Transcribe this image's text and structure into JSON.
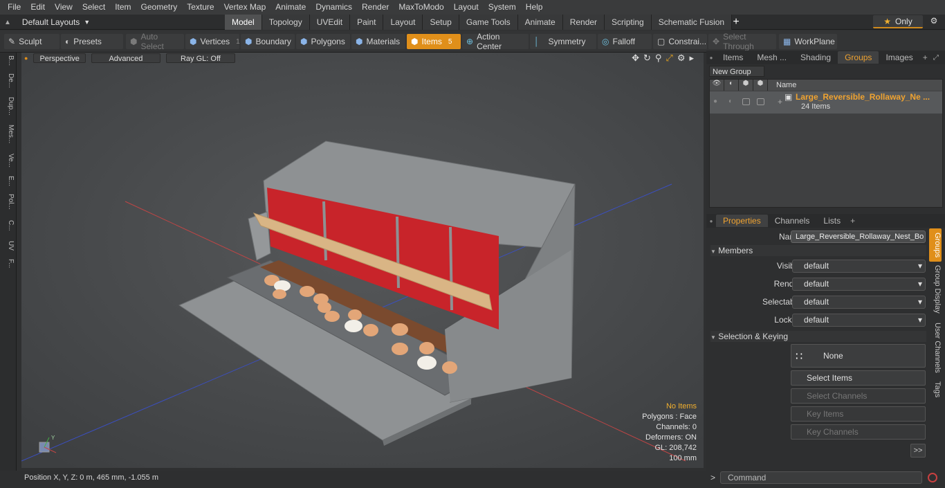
{
  "menu": [
    "File",
    "Edit",
    "View",
    "Select",
    "Item",
    "Geometry",
    "Texture",
    "Vertex Map",
    "Animate",
    "Dynamics",
    "Render",
    "MaxToModo",
    "Layout",
    "System",
    "Help"
  ],
  "layout_selector": "Default Layouts",
  "mode_tabs": [
    "Model",
    "Topology",
    "UVEdit",
    "Paint",
    "Layout",
    "Setup",
    "Game Tools",
    "Animate",
    "Render",
    "Scripting",
    "Schematic Fusion"
  ],
  "active_mode_tab": "Model",
  "only_label": "Only",
  "toolbar": {
    "sculpt": "Sculpt",
    "presets": "Presets",
    "auto_select": "Auto Select",
    "vertices": "Vertices",
    "vertices_count": "1",
    "boundary": "Boundary",
    "polygons": "Polygons",
    "materials": "Materials",
    "items": "Items",
    "items_count": "5",
    "action_center": "Action Center",
    "symmetry": "Symmetry",
    "falloff": "Falloff",
    "constraints": "Constrai...",
    "select_through": "Select Through",
    "workplane": "WorkPlane"
  },
  "left_tabs": [
    "B...",
    "De...",
    "Dup...",
    "Mes...",
    "Ve...",
    "E...",
    "Pol...",
    "C...",
    "UV",
    "F..."
  ],
  "viewport": {
    "view_mode": "Perspective",
    "shading": "Advanced",
    "raygl": "Ray GL: Off",
    "hud": {
      "items": "No Items",
      "polygons": "Polygons : Face",
      "channels": "Channels: 0",
      "deformers": "Deformers: ON",
      "gl": "GL: 208,742",
      "scale": "100 mm"
    }
  },
  "status": {
    "position": "Position X, Y, Z:   0 m, 465 mm, -1.055 m"
  },
  "right_panel": {
    "tabs": [
      "Items",
      "Mesh ...",
      "Shading",
      "Groups",
      "Images"
    ],
    "active_tab": "Groups",
    "new_group": "New Group",
    "col_name": "Name",
    "group_name": "Large_Reversible_Rollaway_Ne ...",
    "group_count": "24 Items",
    "prop_tabs": [
      "Properties",
      "Channels",
      "Lists"
    ],
    "active_prop_tab": "Properties",
    "name_label": "Name",
    "name_value": "Large_Reversible_Rollaway_Nest_Bo",
    "members_header": "Members",
    "visible_label": "Visible",
    "visible_value": "default",
    "render_label": "Render",
    "render_value": "default",
    "selectable_label": "Selectable",
    "selectable_value": "default",
    "locked_label": "Locked",
    "locked_value": "default",
    "selection_header": "Selection & Keying",
    "none_label": "None",
    "select_items": "Select Items",
    "select_channels": "Select Channels",
    "key_items": "Key Items",
    "key_channels": "Key Channels",
    "more": ">>",
    "side_tabs": [
      "Groups",
      "Group Display",
      "User Channels",
      "Tags"
    ]
  },
  "command_placeholder": "Command"
}
